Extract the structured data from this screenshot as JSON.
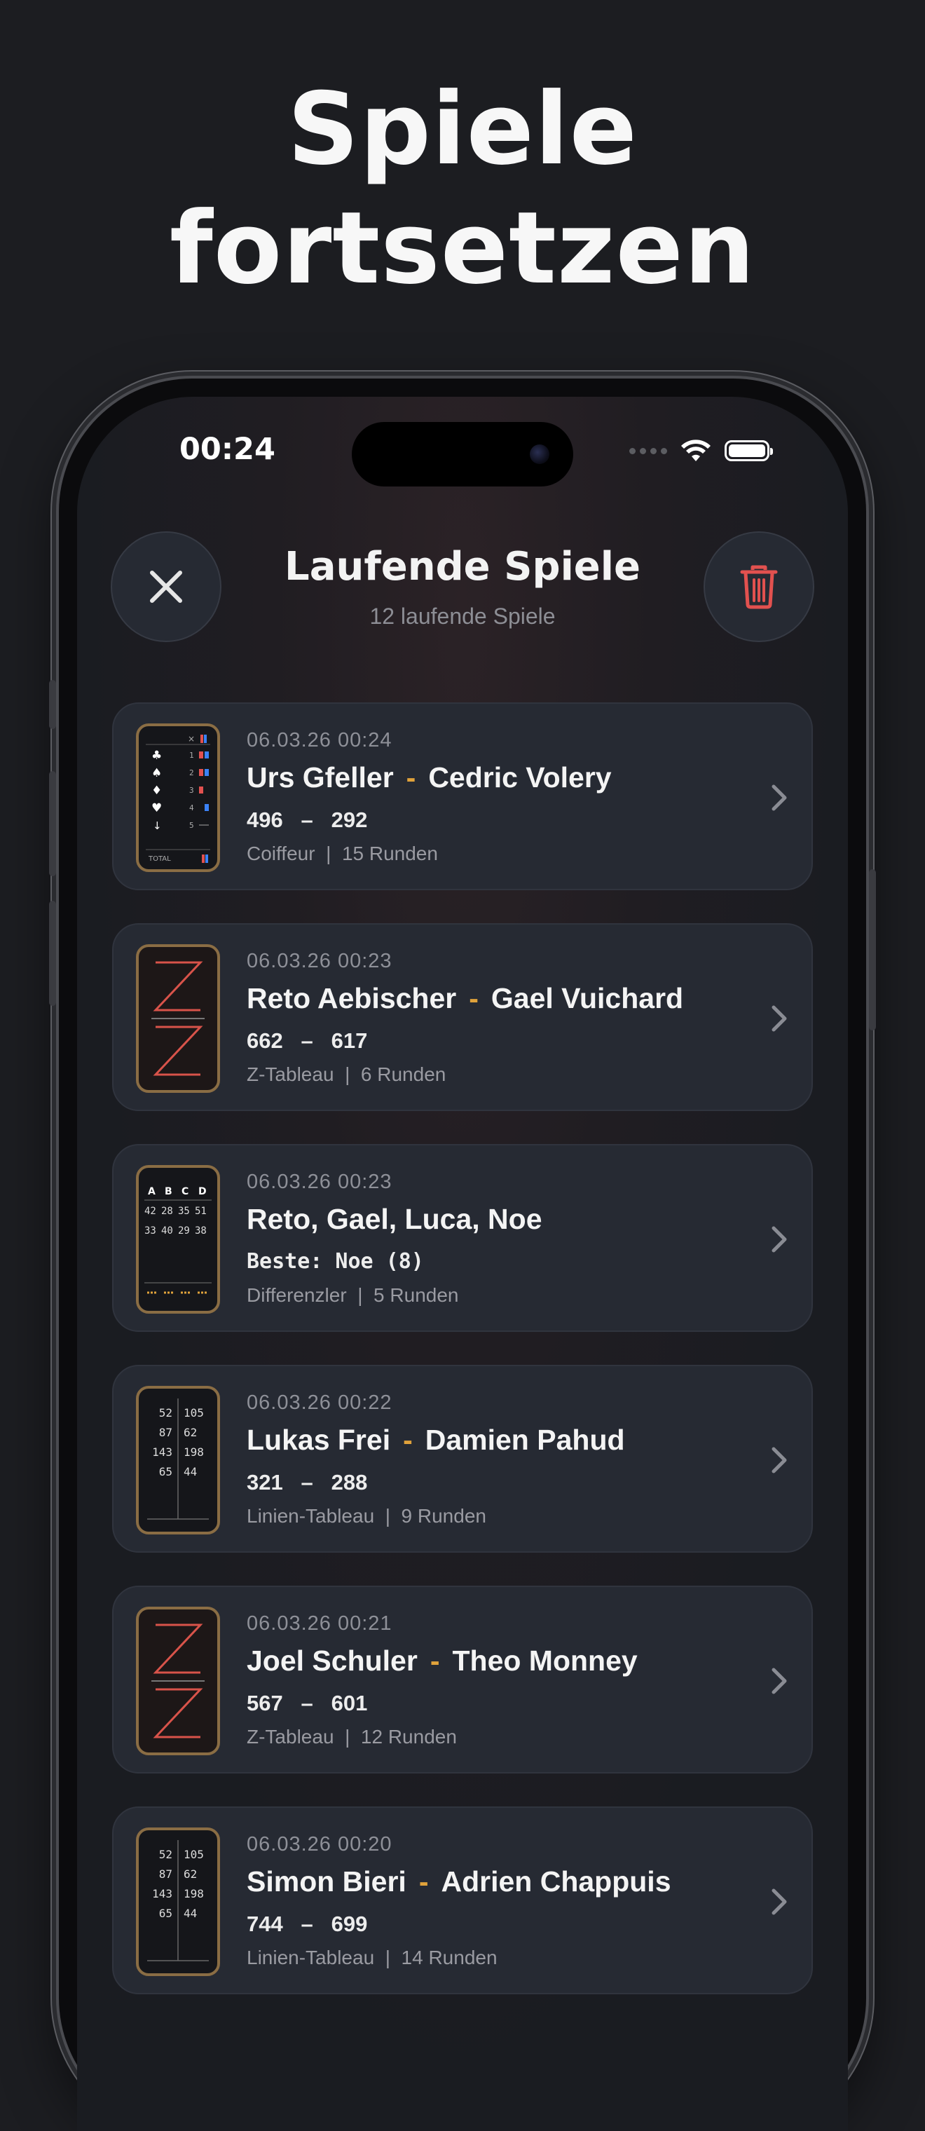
{
  "hero": {
    "line1": "Spiele",
    "line2": "fortsetzen"
  },
  "status_bar": {
    "time": "00:24"
  },
  "header": {
    "title": "Laufende Spiele",
    "subtitle": "12 laufende Spiele"
  },
  "colors": {
    "accent": "#e0a23b",
    "danger": "#e2514f",
    "card": "#262a33",
    "background": "#1c1d21"
  },
  "games": [
    {
      "date": "06.03.26 00:24",
      "player1": "Urs Gfeller",
      "player2": "Cedric Volery",
      "score": "496   –   292",
      "type": "Coiffeur",
      "rounds": "15 Runden",
      "thumb": "coiffeur-icon"
    },
    {
      "date": "06.03.26 00:23",
      "player1": "Reto Aebischer",
      "player2": "Gael Vuichard",
      "score": "662   –   617",
      "type": "Z-Tableau",
      "rounds": "6 Runden",
      "thumb": "z-tableau-icon"
    },
    {
      "date": "06.03.26 00:23",
      "players": "Reto, Gael, Luca, Noe",
      "score": "Beste: Noe (8)",
      "type": "Differenzler",
      "rounds": "5 Runden",
      "thumb": "differenzler-icon"
    },
    {
      "date": "06.03.26 00:22",
      "player1": "Lukas Frei",
      "player2": "Damien Pahud",
      "score": "321   –   288",
      "type": "Linien-Tableau",
      "rounds": "9 Runden",
      "thumb": "linien-tableau-icon"
    },
    {
      "date": "06.03.26 00:21",
      "player1": "Joel Schuler",
      "player2": "Theo Monney",
      "score": "567   –   601",
      "type": "Z-Tableau",
      "rounds": "12 Runden",
      "thumb": "z-tableau-icon"
    },
    {
      "date": "06.03.26 00:20",
      "player1": "Simon Bieri",
      "player2": "Adrien Chappuis",
      "score": "744   –   699",
      "type": "Linien-Tableau",
      "rounds": "14 Runden",
      "thumb": "linien-tableau-icon"
    }
  ],
  "thumbs": {
    "coiffeur": {
      "rows": [
        "1",
        "2",
        "3",
        "4",
        "5"
      ],
      "total": "TOTAL"
    },
    "differenzler": {
      "cols": [
        "A",
        "B",
        "C",
        "D"
      ],
      "row1": [
        "42",
        "28",
        "35",
        "51"
      ],
      "row2": [
        "33",
        "40",
        "29",
        "38"
      ]
    },
    "linien": {
      "left": [
        "52",
        "87",
        "143",
        "65"
      ],
      "right": [
        "105",
        "62",
        "198",
        "44"
      ]
    }
  }
}
